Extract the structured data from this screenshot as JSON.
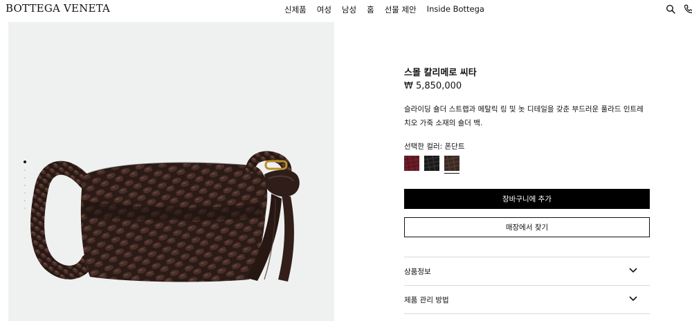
{
  "header": {
    "logo": "BOTTEGA VENETA",
    "nav": [
      "신제품",
      "여성",
      "남성",
      "홈",
      "선물 제안",
      "Inside Bottega"
    ],
    "icons": [
      "search-icon",
      "phone-icon"
    ]
  },
  "gallery": {
    "image_alt": "Small Kalimero Città shoulder bag in fondant woven leather",
    "slide_count": 7,
    "active_slide": 1
  },
  "product": {
    "title": "스몰 칼리메로 씨타",
    "price": "₩ 5,850,000",
    "description": "슬라이딩 숄더 스트랩과 메탈릭 링 및 놋 디테일을 갖춘 부드러운 풀라드 인트레치오 가죽 소재의 숄더 백.",
    "color_label": "선택한 컬러: 폰단트",
    "swatches": [
      {
        "name": "burgundy",
        "color": "#6e1d28"
      },
      {
        "name": "black",
        "color": "#1a1a1a"
      },
      {
        "name": "fondant",
        "color": "#3b2a24",
        "selected": true
      }
    ],
    "add_to_cart": "장바구니에 추가",
    "find_in_store": "매장에서 찾기"
  },
  "accordion": [
    {
      "label": "상품정보"
    },
    {
      "label": "제품 관리 방법"
    }
  ],
  "colors": {
    "bag_dark": "#2b1b17",
    "bag_mid": "#3d2822",
    "bag_light": "#5a3d34",
    "image_bg": "#eff1f0",
    "gold": "#b8902e"
  }
}
